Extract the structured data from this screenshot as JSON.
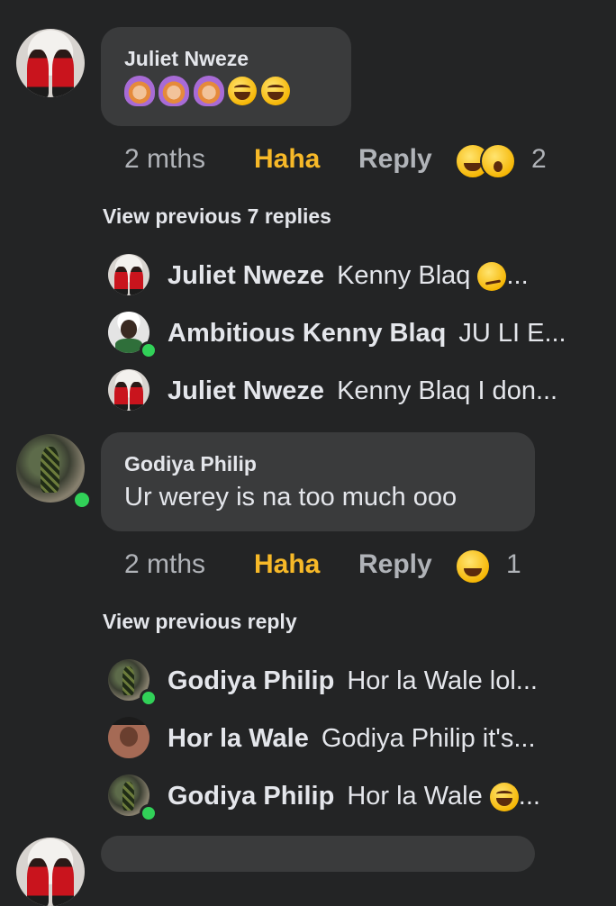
{
  "comments": [
    {
      "author": "Juliet Nweze",
      "text": "",
      "emojis": [
        "pray",
        "pray",
        "pray",
        "laugh",
        "laugh"
      ],
      "time": "2 mths",
      "reaction_label": "Haha",
      "reply_label": "Reply",
      "reaction_count": "2",
      "view_previous": "View previous 7 replies",
      "replies": [
        {
          "author": "Juliet Nweze",
          "text": "Kenny Blaq ",
          "emoji": "smirk",
          "suffix": "..."
        },
        {
          "author": "Ambitious Kenny Blaq",
          "text": "JU LI E...",
          "emoji": "",
          "suffix": ""
        },
        {
          "author": "Juliet Nweze",
          "text": "Kenny Blaq I don...",
          "emoji": "",
          "suffix": ""
        }
      ]
    },
    {
      "author": "Godiya Philip",
      "text": "Ur werey is na too much ooo",
      "time": "2 mths",
      "reaction_label": "Haha",
      "reply_label": "Reply",
      "reaction_count": "1",
      "view_previous": "View previous reply",
      "replies": [
        {
          "author": "Godiya Philip",
          "text": "Hor la Wale lol...",
          "emoji": "",
          "suffix": ""
        },
        {
          "author": "Hor la Wale",
          "text": "Godiya Philip it's...",
          "emoji": "",
          "suffix": ""
        },
        {
          "author": "Godiya Philip",
          "text": "Hor la Wale ",
          "emoji": "laugh",
          "suffix": "..."
        }
      ]
    }
  ],
  "colors": {
    "background": "#232425",
    "bubble": "#3a3b3c",
    "haha": "#f7b928",
    "muted": "#b0b3b8",
    "online": "#31d158"
  }
}
